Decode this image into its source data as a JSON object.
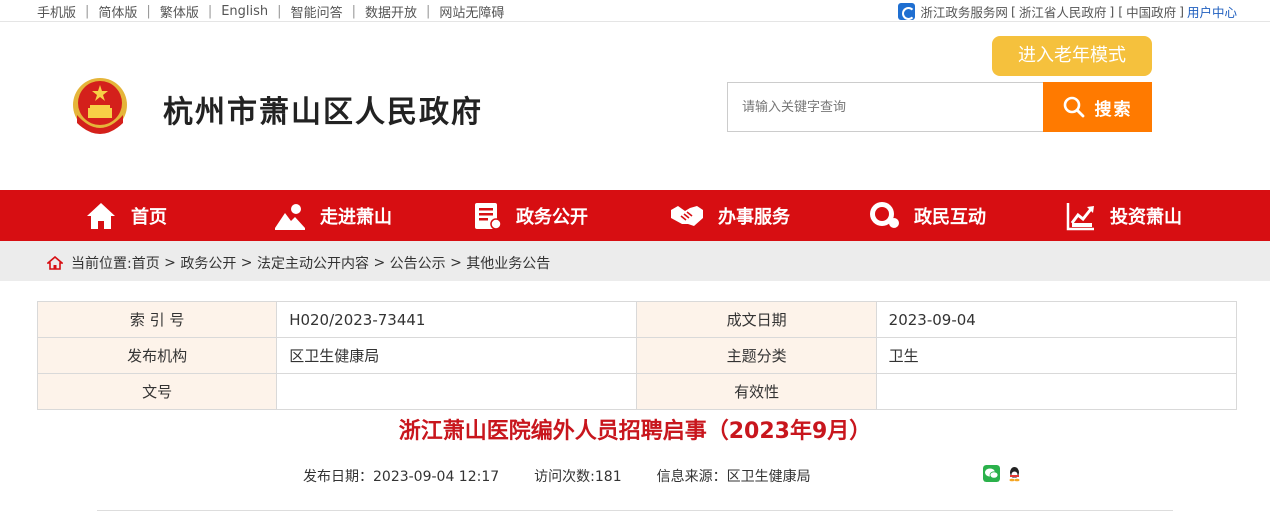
{
  "topbar": {
    "links": [
      "手机版",
      "简体版",
      "繁体版",
      "English",
      "智能问答",
      "数据开放",
      "网站无障碍"
    ],
    "right": [
      "浙江政务服务网",
      "浙江省人民政府",
      "中国政府"
    ],
    "user_center": "用户中心"
  },
  "header": {
    "title": "杭州市萧山区人民政府",
    "elder_mode": "进入老年模式",
    "search_placeholder": "请输入关键字查询",
    "search_button": "搜索"
  },
  "nav": [
    {
      "label": "首页",
      "icon": "home-icon"
    },
    {
      "label": "走进萧山",
      "icon": "landscape-icon"
    },
    {
      "label": "政务公开",
      "icon": "document-icon"
    },
    {
      "label": "办事服务",
      "icon": "handshake-icon"
    },
    {
      "label": "政民互动",
      "icon": "chat-icon"
    },
    {
      "label": "投资萧山",
      "icon": "chart-icon"
    }
  ],
  "breadcrumb": {
    "prefix": "当前位置:",
    "items": [
      "首页",
      "政务公开",
      "法定主动公开内容",
      "公告公示",
      "其他业务公告"
    ]
  },
  "info": {
    "rows": [
      [
        {
          "k": "索 引 号",
          "v": "H020/2023-73441"
        },
        {
          "k": "成文日期",
          "v": "2023-09-04"
        }
      ],
      [
        {
          "k": "发布机构",
          "v": "区卫生健康局"
        },
        {
          "k": "主题分类",
          "v": "卫生"
        }
      ],
      [
        {
          "k": "文号",
          "v": ""
        },
        {
          "k": "有效性",
          "v": ""
        }
      ]
    ]
  },
  "article": {
    "title": "浙江萧山医院编外人员招聘启事（2023年9月）",
    "publish_date": "发布日期：2023-09-04 12:17",
    "visits": "访问次数:181",
    "source": "信息来源：区卫生健康局"
  },
  "colors": {
    "nav_red": "#d70e12",
    "search_orange": "#ff7a00",
    "elder_yellow": "#f5c13d",
    "title_red": "#c8161d"
  }
}
